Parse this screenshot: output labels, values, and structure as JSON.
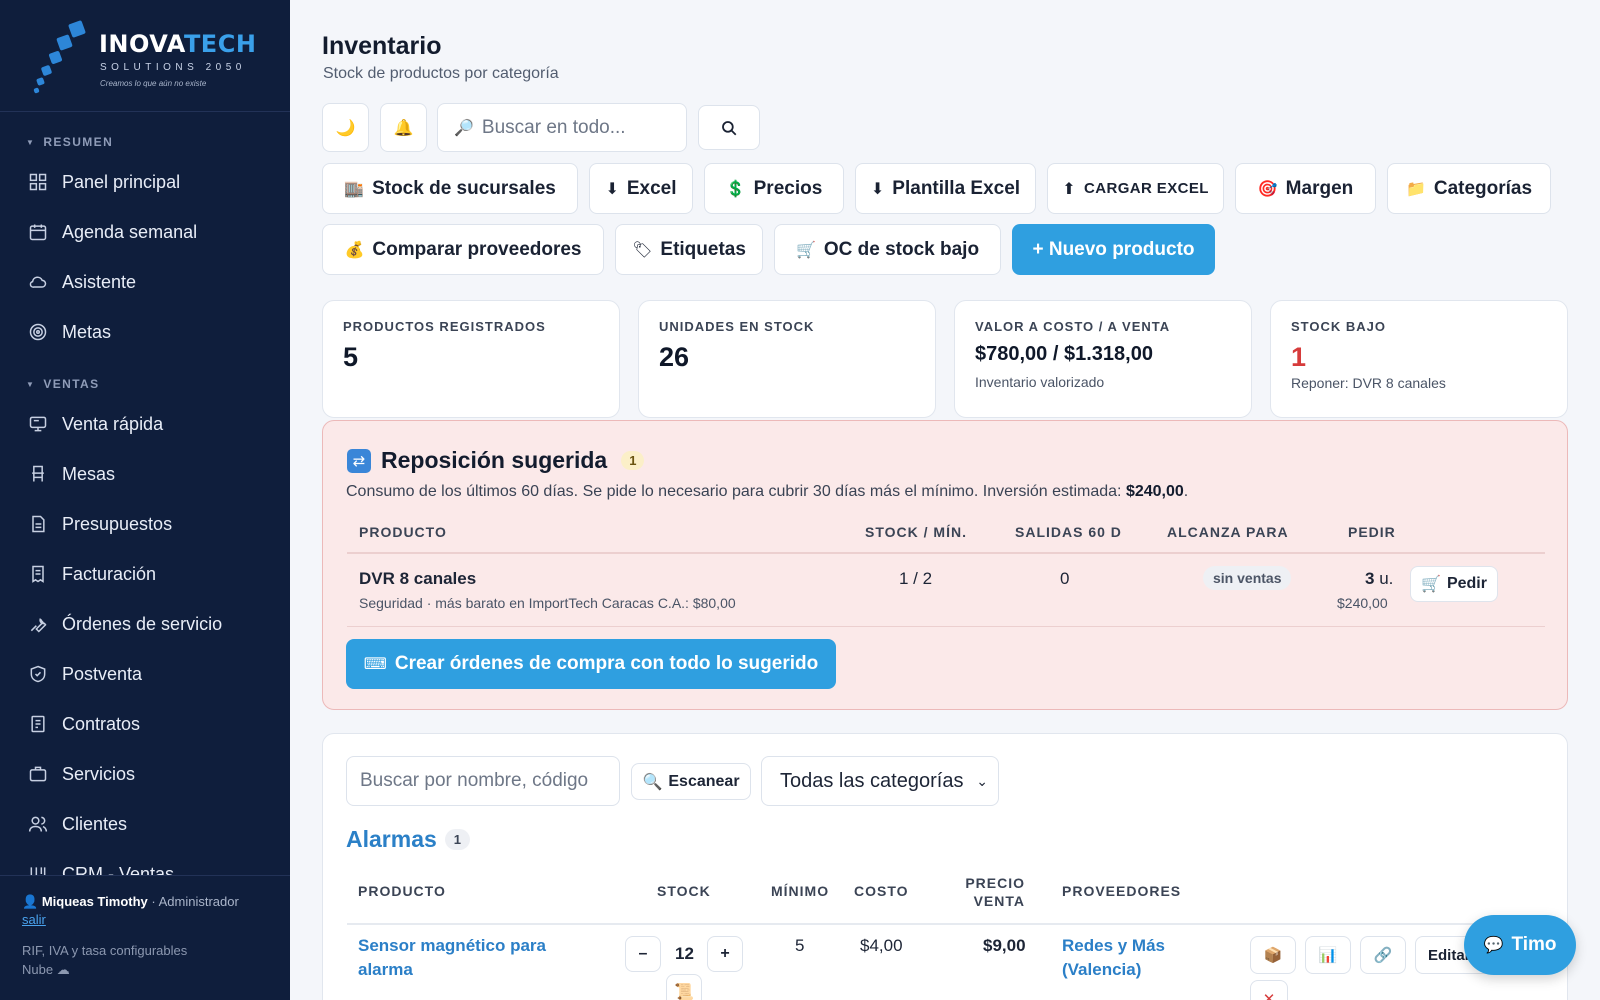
{
  "brand": {
    "name_a": "INOVA",
    "name_b": "TECH",
    "subtitle": "SOLUTIONS 2050",
    "tagline": "Creamos lo que aún no existe",
    "accent": "#3aa0ea"
  },
  "sidebar": {
    "sections": [
      {
        "title": "RESUMEN"
      },
      {
        "title": "VENTAS"
      }
    ],
    "items": [
      {
        "label": "Panel principal",
        "icon": "dashboard-icon"
      },
      {
        "label": "Agenda semanal",
        "icon": "calendar-icon"
      },
      {
        "label": "Asistente",
        "icon": "cloud-icon"
      },
      {
        "label": "Metas",
        "icon": "target-icon"
      },
      {
        "label": "Venta rápida",
        "icon": "register-icon"
      },
      {
        "label": "Mesas",
        "icon": "chair-icon"
      },
      {
        "label": "Presupuestos",
        "icon": "document-icon"
      },
      {
        "label": "Facturación",
        "icon": "receipt-icon"
      },
      {
        "label": "Órdenes de servicio",
        "icon": "wrench-icon"
      },
      {
        "label": "Postventa",
        "icon": "shield-icon"
      },
      {
        "label": "Contratos",
        "icon": "contract-icon"
      },
      {
        "label": "Servicios",
        "icon": "briefcase-icon"
      },
      {
        "label": "Clientes",
        "icon": "users-icon"
      },
      {
        "label": "CRM - Ventas",
        "icon": "kanban-icon"
      }
    ],
    "footer": {
      "user": "Miqueas Timothy",
      "role": "· Administrador",
      "logout": "salir",
      "line1": "RIF, IVA y tasa configurables",
      "line2": "Nube"
    }
  },
  "header": {
    "title": "Inventario",
    "subtitle": "Stock de productos por categoría",
    "search_placeholder": "Buscar en todo..."
  },
  "toolbar": {
    "row1": [
      {
        "label": "Stock de sucursales",
        "emoji": "🏬"
      },
      {
        "label": "Excel",
        "emoji": "⬇"
      },
      {
        "label": "Precios",
        "emoji": "💲"
      },
      {
        "label": "Plantilla Excel",
        "emoji": "⬇"
      },
      {
        "label": "CARGAR EXCEL",
        "emoji": "⬆"
      },
      {
        "label": "Margen",
        "emoji": "🎯"
      },
      {
        "label": "Categorías",
        "emoji": "📁"
      }
    ],
    "row2": [
      {
        "label": "Comparar proveedores",
        "emoji": "💰"
      },
      {
        "label": "Etiquetas",
        "emoji": "🏷"
      },
      {
        "label": "OC de stock bajo",
        "emoji": "🛒"
      },
      {
        "label": "+ Nuevo producto",
        "emoji": ""
      }
    ]
  },
  "stats": [
    {
      "label": "PRODUCTOS REGISTRADOS",
      "value": "5",
      "note": ""
    },
    {
      "label": "UNIDADES EN STOCK",
      "value": "26",
      "note": ""
    },
    {
      "label": "VALOR A COSTO / A VENTA",
      "value": "$780,00 / $1.318,00",
      "note": "Inventario valorizado"
    },
    {
      "label": "STOCK BAJO",
      "value": "1",
      "note": "Reponer: DVR 8 canales"
    }
  ],
  "reposicion": {
    "title": "Reposición sugerida",
    "count": "1",
    "desc": "Consumo de los últimos 60 días. Se pide lo necesario para cubrir 30 días más el mínimo. Inversión estimada: ",
    "desc_amount": "$240,00",
    "desc_end": ".",
    "columns": [
      "PRODUCTO",
      "STOCK / MÍN.",
      "SALIDAS 60 D",
      "ALCANZA PARA",
      "PEDIR"
    ],
    "rows": [
      {
        "name": "DVR 8 canales",
        "detail": "Seguridad · más barato en ImportTech Caracas C.A.: $80,00",
        "stock": "1 / 2",
        "salidas": "0",
        "alcanza": "sin ventas",
        "pedir_qty": "3",
        "pedir_unit": "u.",
        "pedir_amount": "$240,00",
        "action": "Pedir"
      }
    ],
    "cta": "Crear órdenes de compra con todo lo sugerido"
  },
  "product_list": {
    "search_placeholder": "Buscar por nombre, código",
    "scan_label": "Escanear",
    "category_select": "Todas las categorías",
    "group_title": "Alarmas",
    "group_count": "1",
    "columns": [
      "PRODUCTO",
      "STOCK",
      "MÍNIMO",
      "COSTO",
      "PRECIO VENTA",
      "PROVEEDORES"
    ],
    "col_precio_a": "PRECIO",
    "col_precio_b": "VENTA",
    "rows": [
      {
        "name_a": "Sensor magnético para",
        "name_b": "alarma",
        "stock": "12",
        "minimo": "5",
        "costo": "$4,00",
        "precio": "$9,00",
        "prov_a": "Redes y Más",
        "prov_b": "(Valencia)",
        "edit": "Editar"
      }
    ]
  },
  "assistant": {
    "label": "Timo"
  }
}
